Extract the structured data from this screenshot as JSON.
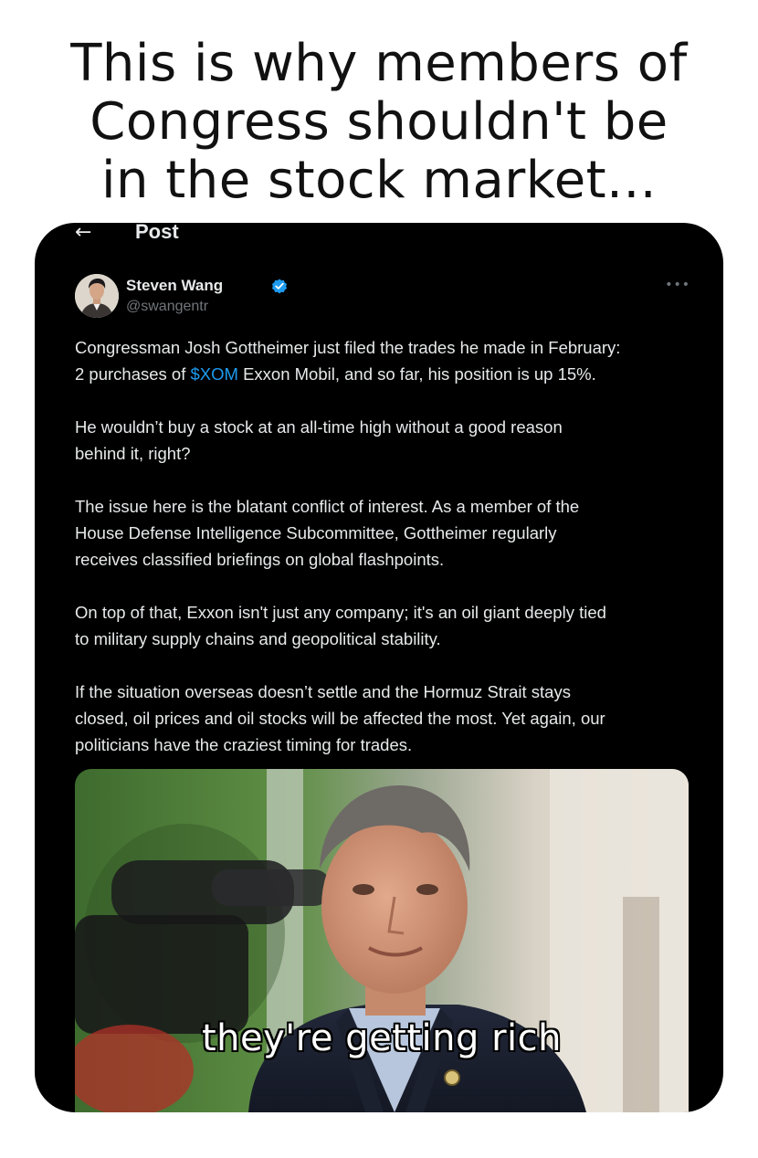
{
  "meme": {
    "caption_lines": [
      "This is why members of",
      "Congress shouldn't be",
      "in the stock market..."
    ]
  },
  "topbar": {
    "back_icon": "arrow-left-icon",
    "title": "Post"
  },
  "author": {
    "name": "Steven Wang",
    "handle": "@swangentr",
    "verified_icon": "verified-badge-icon",
    "verified_color": "#1d9bf0",
    "more_icon": "more-horizontal-icon"
  },
  "tweet": {
    "p1_line1": "Congressman Josh Gottheimer just filed the trades he made in February:",
    "p1_line2_before": "2 purchases of ",
    "cashtag": "$XOM",
    "p1_line2_after": " Exxon Mobil, and so far, his position is up 15%.",
    "p2_line1": "He wouldn’t buy a stock at an all-time high without a good reason",
    "p2_line2": "behind it, right?",
    "p3_line1": "The issue here is the blatant conflict of interest. As a member of the",
    "p3_line2": "House Defense Intelligence Subcommittee, Gottheimer regularly",
    "p3_line3": "receives classified briefings on global flashpoints.",
    "p4_line1": "On top of that, Exxon isn't just any company; it's an oil giant deeply tied",
    "p4_line2": "to military supply chains and geopolitical stability.",
    "p5_line1": "If the situation overseas doesn’t settle and the Hormuz Strait stays",
    "p5_line2": "closed, oil prices and oil stocks will be affected the most. Yet again, our",
    "p5_line3": "politicians have the craziest timing for trades."
  },
  "media": {
    "caption": "they're getting rich"
  },
  "colors": {
    "background": "#000000",
    "text": "#e7e9ea",
    "secondary_text": "#71767b",
    "link": "#1d9bf0"
  }
}
